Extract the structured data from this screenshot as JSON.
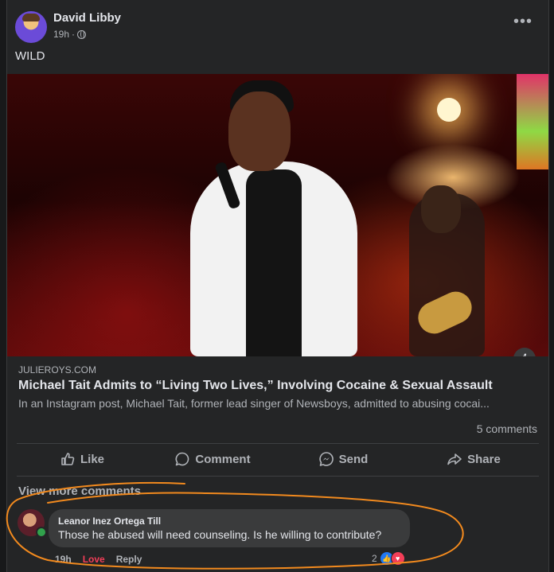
{
  "post": {
    "author": "David Libby",
    "time": "19h",
    "more_icon": "•••",
    "text": "WILD"
  },
  "link_preview": {
    "domain": "JULIEROYS.COM",
    "title": "Michael Tait Admits to “Living Two Lives,” Involving Cocaine & Sexual Assault",
    "description": "In an Instagram post, Michael Tait, former lead singer of Newsboys, admitted to abusing cocai...",
    "info_icon": "i"
  },
  "stats": {
    "comments": "5 comments"
  },
  "actions": {
    "like": "Like",
    "comment": "Comment",
    "send": "Send",
    "share": "Share"
  },
  "comments": {
    "view_more": "View more comments",
    "items": [
      {
        "name": "Leanor Inez Ortega Till",
        "text": "Those he abused will need counseling. Is he willing to contribute?",
        "time": "19h",
        "reaction_label": "Love",
        "reply": "Reply",
        "reaction_count": "2"
      }
    ]
  },
  "colors": {
    "background": "#18191a",
    "card": "#242526",
    "annotation": "#f28a1e",
    "love": "#f33e58",
    "like": "#2078f4"
  }
}
